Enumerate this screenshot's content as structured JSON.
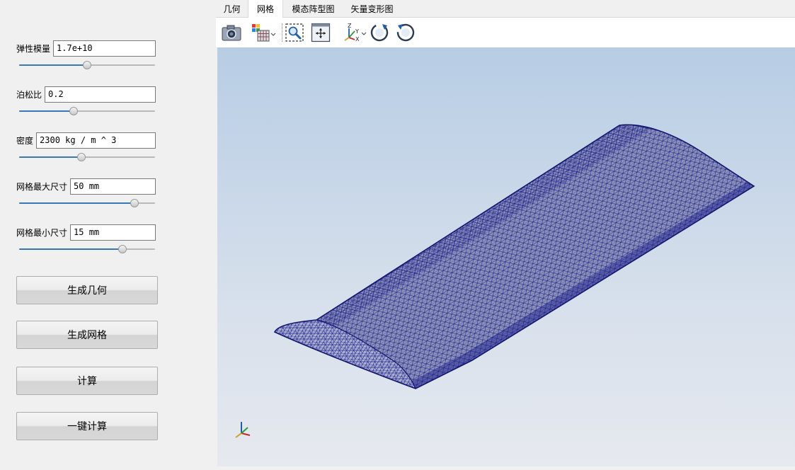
{
  "tabs": [
    {
      "label": "几何"
    },
    {
      "label": "网格"
    },
    {
      "label": "模态阵型图"
    },
    {
      "label": "矢量变形图"
    }
  ],
  "active_tab": "网格",
  "params": {
    "elastic_modulus": {
      "label": "弹性模量",
      "value": "1.7e+10",
      "slider": 0.5
    },
    "poisson_ratio": {
      "label": "泊松比",
      "value": "0.2",
      "slider": 0.4
    },
    "density": {
      "label": "密度",
      "value": "2300 kg / m ^ 3",
      "slider": 0.46
    },
    "mesh_max": {
      "label": "网格最大尺寸",
      "value": "50 mm",
      "slider": 0.85
    },
    "mesh_min": {
      "label": "网格最小尺寸",
      "value": "15 mm",
      "slider": 0.76
    }
  },
  "buttons": {
    "gen_geometry": "生成几何",
    "gen_mesh": "生成网格",
    "compute": "计算",
    "one_click": "一键计算"
  },
  "toolbar_icons": [
    "camera-icon",
    "display-mode-icon",
    "zoom-box-icon",
    "fit-view-icon",
    "axis-orientation-icon",
    "rotate-cw-icon",
    "rotate-ccw-icon"
  ],
  "colors": {
    "mesh_line": "#1a1d8c",
    "mesh_fill": "#8d92b8",
    "slider_fill": "#3a77b5",
    "viewport_top": "#b7cde4",
    "viewport_bottom": "#e6e9ef"
  }
}
